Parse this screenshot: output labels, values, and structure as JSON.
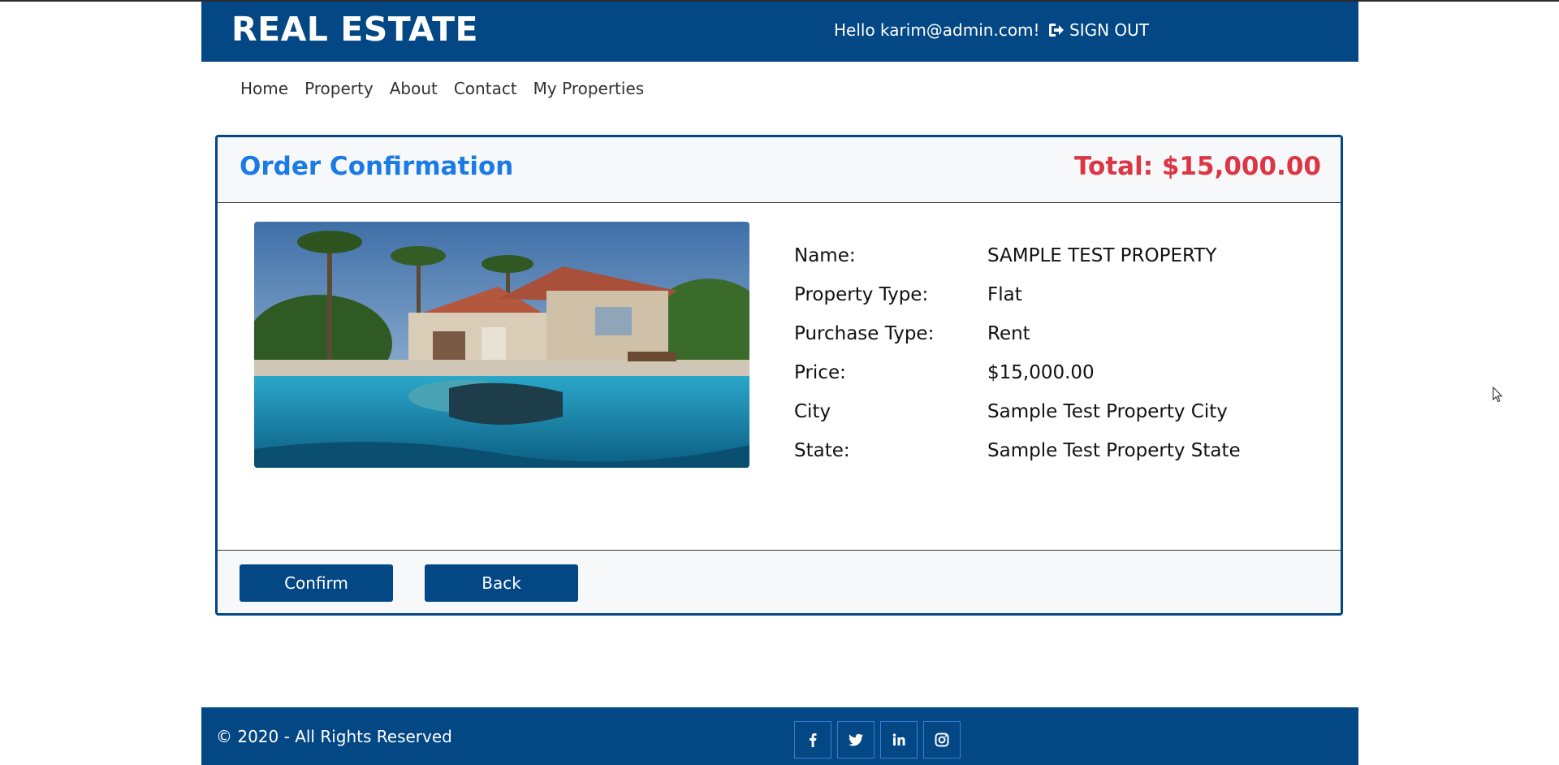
{
  "header": {
    "brand": "REAL ESTATE",
    "greeting": "Hello karim@admin.com!",
    "signout_label": "SIGN OUT"
  },
  "nav": {
    "items": [
      "Home",
      "Property",
      "About",
      "Contact",
      "My Properties"
    ]
  },
  "order": {
    "title": "Order Confirmation",
    "total": "Total: $15,000.00",
    "details": [
      {
        "label": "Name:",
        "value": "SAMPLE TEST PROPERTY"
      },
      {
        "label": "Property Type:",
        "value": "Flat"
      },
      {
        "label": "Purchase Type:",
        "value": "Rent"
      },
      {
        "label": "Price:",
        "value": "$15,000.00"
      },
      {
        "label": "City",
        "value": "Sample Test Property City"
      },
      {
        "label": "State:",
        "value": "Sample Test Property State"
      }
    ],
    "confirm_label": "Confirm",
    "back_label": "Back"
  },
  "footer": {
    "copyright": "© 2020 - All Rights Reserved",
    "socials": [
      "facebook-icon",
      "twitter-icon",
      "linkedin-icon",
      "instagram-icon"
    ]
  },
  "colors": {
    "primary": "#034785",
    "title_blue": "#1a7ae6",
    "total_red": "#dc3545"
  }
}
